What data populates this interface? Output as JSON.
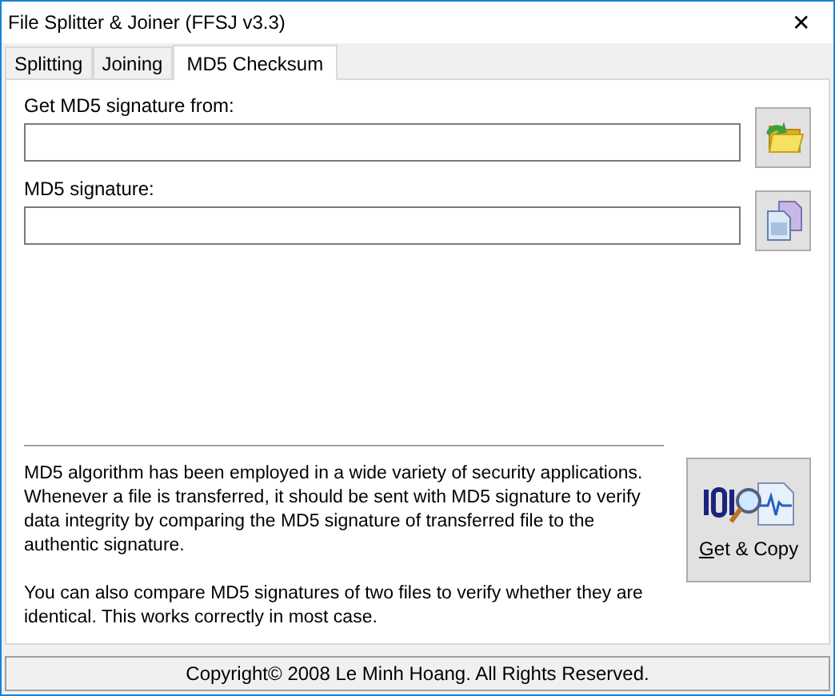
{
  "window": {
    "title": "File Splitter & Joiner (FFSJ v3.3)",
    "close": "✕"
  },
  "tabs": [
    {
      "label": "Splitting",
      "selected": false
    },
    {
      "label": "Joining",
      "selected": false
    },
    {
      "label": "MD5 Checksum",
      "selected": true
    }
  ],
  "source": {
    "label": "Get MD5 signature from:"
  },
  "signature": {
    "label": "MD5 signature:"
  },
  "info": [
    "MD5 algorithm has been employed in a wide variety of security applications. Whenever a file is transferred, it should be sent with MD5 signature to verify data integrity by comparing the MD5 signature of transferred file to the authentic signature.",
    "You can also compare MD5 signatures of two files to verify whether they are identical. This works correctly in most case."
  ],
  "get_copy_button": {
    "label": "Get & Copy"
  },
  "status_bar": "Copyright© 2008 Le Minh Hoang. All Rights Reserved."
}
